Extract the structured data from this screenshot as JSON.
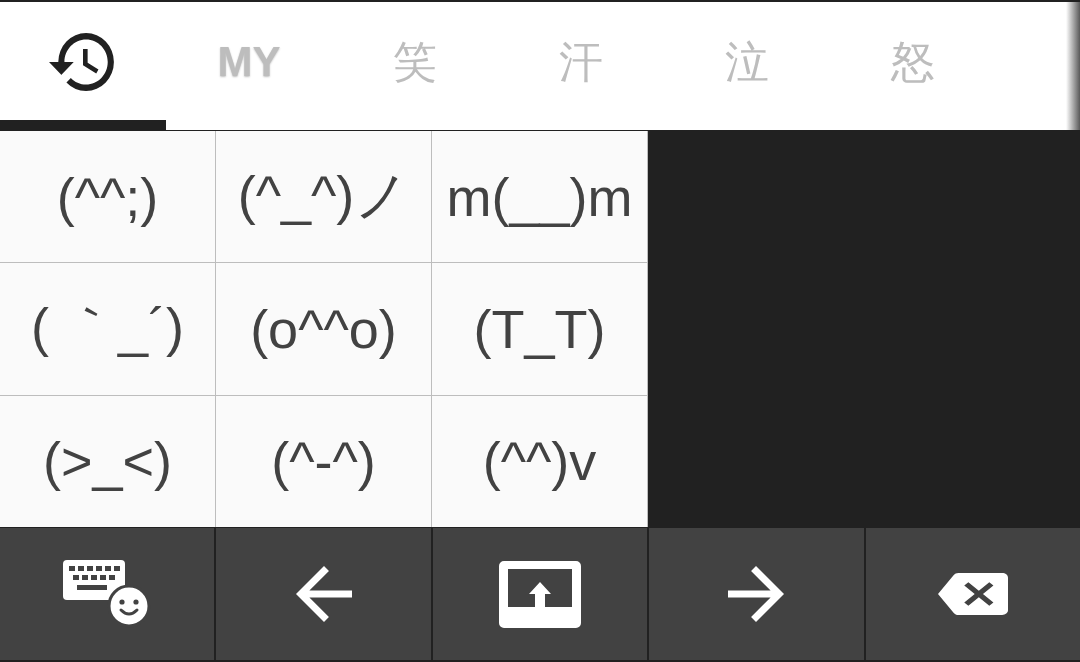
{
  "tabs": [
    {
      "kind": "history",
      "selected": true
    },
    {
      "kind": "custom",
      "label": "MY",
      "selected": false
    },
    {
      "kind": "category",
      "label": "笑",
      "selected": false
    },
    {
      "kind": "category",
      "label": "汗",
      "selected": false
    },
    {
      "kind": "category",
      "label": "泣",
      "selected": false
    },
    {
      "kind": "category",
      "label": "怒",
      "selected": false
    }
  ],
  "emoticons": [
    "(^^;)",
    "(^_^)ノ",
    "m(__)m",
    "( ｀_´)",
    "(o^^o)",
    "(T_T)",
    "(>_<)",
    "(^-^)",
    "(^^)v"
  ],
  "keys": [
    {
      "kind": "keyboard-switch"
    },
    {
      "kind": "cursor-left"
    },
    {
      "kind": "commit"
    },
    {
      "kind": "cursor-right"
    },
    {
      "kind": "backspace"
    }
  ]
}
